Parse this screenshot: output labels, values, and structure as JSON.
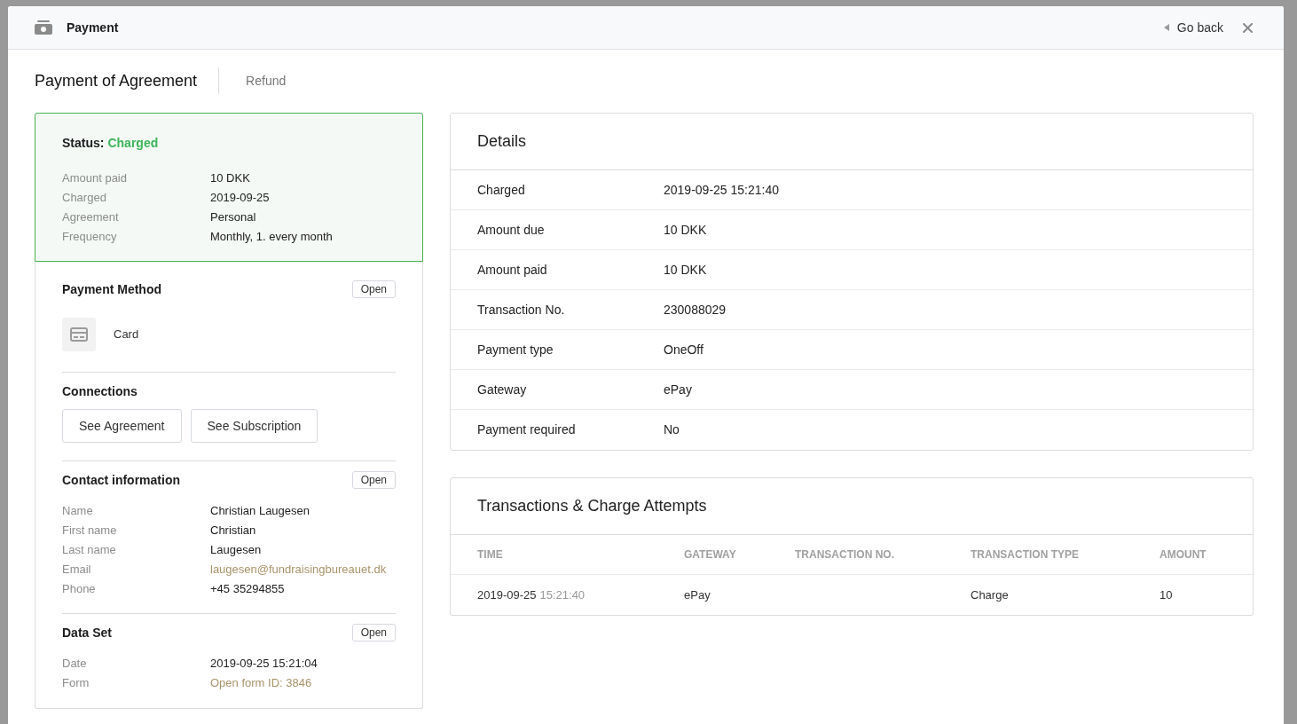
{
  "window": {
    "title": "Payment",
    "go_back": "Go back"
  },
  "page_title": "Payment of Agreement",
  "refund_link": "Refund",
  "status_card": {
    "label": "Status:",
    "status": "Charged",
    "rows": [
      {
        "label": "Amount paid",
        "value": "10 DKK"
      },
      {
        "label": "Charged",
        "value": "2019-09-25"
      },
      {
        "label": "Agreement",
        "value": "Personal"
      },
      {
        "label": "Frequency",
        "value": "Monthly, 1. every month"
      }
    ]
  },
  "payment_method": {
    "title": "Payment Method",
    "open_button": "Open",
    "method": "Card"
  },
  "connections": {
    "title": "Connections",
    "buttons": [
      "See Agreement",
      "See Subscription"
    ]
  },
  "contact_information": {
    "title": "Contact information",
    "open_button": "Open",
    "rows": [
      {
        "label": "Name",
        "value": "Christian Laugesen",
        "kind": "text"
      },
      {
        "label": "First name",
        "value": "Christian",
        "kind": "text"
      },
      {
        "label": "Last name",
        "value": "Laugesen",
        "kind": "text"
      },
      {
        "label": "Email",
        "value": "laugesen@fundraisingbureauet.dk",
        "kind": "link"
      },
      {
        "label": "Phone",
        "value": "+45 35294855",
        "kind": "text"
      }
    ]
  },
  "data_set": {
    "title": "Data Set",
    "open_button": "Open",
    "rows": [
      {
        "label": "Date",
        "value": "2019-09-25 15:21:04",
        "kind": "text"
      },
      {
        "label": "Form",
        "value": "Open form ID: 3846",
        "kind": "link"
      }
    ]
  },
  "details": {
    "title": "Details",
    "rows": [
      {
        "label": "Charged",
        "value": "2019-09-25 15:21:40"
      },
      {
        "label": "Amount due",
        "value": "10 DKK"
      },
      {
        "label": "Amount paid",
        "value": "10 DKK"
      },
      {
        "label": "Transaction No.",
        "value": "230088029"
      },
      {
        "label": "Payment type",
        "value": "OneOff"
      },
      {
        "label": "Gateway",
        "value": "ePay"
      },
      {
        "label": "Payment required",
        "value": "No"
      }
    ]
  },
  "transactions": {
    "title": "Transactions & Charge Attempts",
    "columns": [
      "TIME",
      "GATEWAY",
      "TRANSACTION NO.",
      "TRANSACTION TYPE",
      "AMOUNT"
    ],
    "rows": [
      {
        "date": "2019-09-25",
        "time": "15:21:40",
        "gateway": "ePay",
        "transaction_type": "Charge",
        "amount": "10"
      }
    ]
  }
}
